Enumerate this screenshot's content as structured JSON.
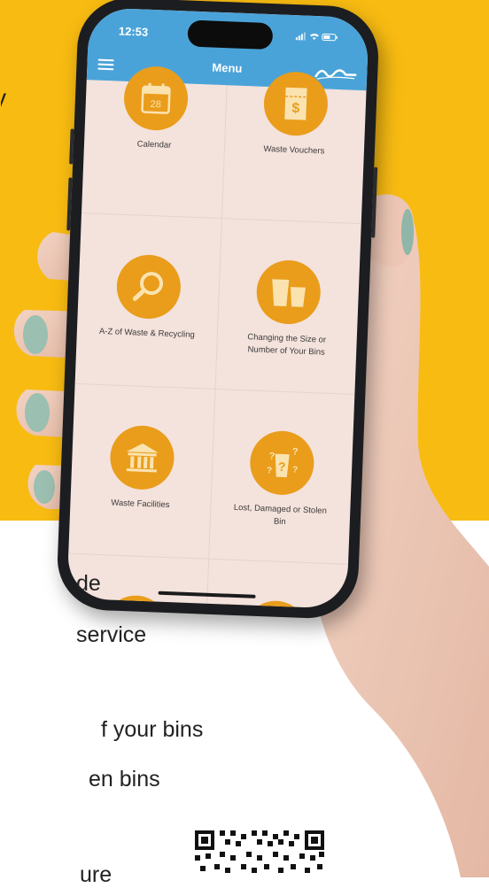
{
  "page": {
    "background_color": "#f8bb12",
    "edge_fragment": "y",
    "bottom_fragments": [
      "de",
      "service",
      "f your bins",
      "en bins",
      "ure"
    ]
  },
  "phone": {
    "status": {
      "time": "12:53"
    },
    "header": {
      "title": "Menu",
      "menu_icon": "hamburger-icon",
      "logo": "council-logo"
    },
    "accent_color": "#e99d1b",
    "header_color": "#4aa3d8",
    "tiles": [
      {
        "label": "Calendar",
        "icon": "calendar-icon",
        "calendar_day": "28"
      },
      {
        "label": "Waste Vouchers",
        "icon": "voucher-icon",
        "symbol": "$"
      },
      {
        "label": "A-Z of Waste & Recycling",
        "icon": "magnifier-icon"
      },
      {
        "label": "Changing the Size or Number of Your Bins",
        "icon": "bins-icon"
      },
      {
        "label": "Waste Facilities",
        "icon": "building-icon"
      },
      {
        "label": "Lost, Damaged or Stolen Bin",
        "icon": "question-bin-icon"
      }
    ]
  },
  "qr_code": {
    "icon": "qr-code"
  }
}
